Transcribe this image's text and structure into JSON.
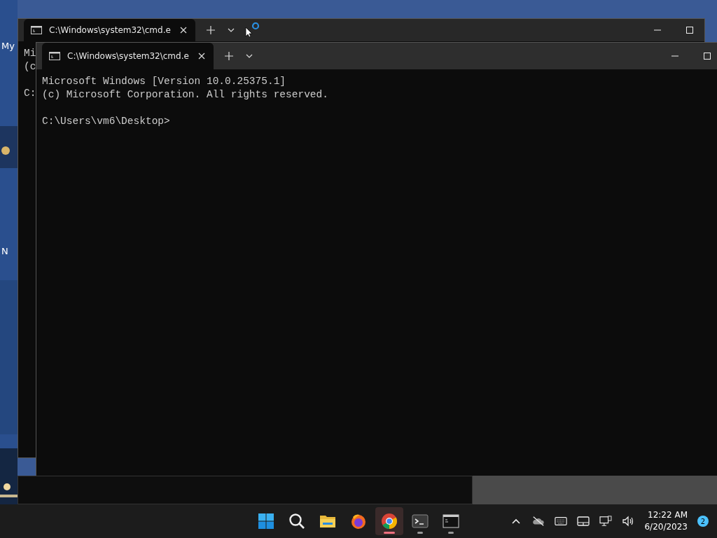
{
  "desktop": {
    "icon_labels": [
      "My",
      "N"
    ]
  },
  "windows": [
    {
      "tab": {
        "title": "C:\\Windows\\system32\\cmd.e",
        "selected": true
      },
      "blocks": [
        [
          "Mi",
          "(c"
        ],
        [
          "C:"
        ]
      ]
    },
    {
      "tab": {
        "title": "C:\\Windows\\system32\\cmd.e",
        "selected": true
      },
      "blocks": [
        [
          "Microsoft Windows [Version 10.0.25375.1]",
          "(c) Microsoft Corporation. All rights reserved."
        ],
        [
          "C:\\Users\\vm6\\Desktop>"
        ]
      ]
    }
  ],
  "taskbar": {
    "apps": [
      {
        "kind": "start",
        "selected": false,
        "running": false
      },
      {
        "kind": "search",
        "selected": false,
        "running": false
      },
      {
        "kind": "files",
        "selected": false,
        "running": false
      },
      {
        "kind": "firefox",
        "selected": false,
        "running": false
      },
      {
        "kind": "chrome",
        "selected": true,
        "running": true
      },
      {
        "kind": "terminal",
        "selected": false,
        "running": true
      },
      {
        "kind": "cmd",
        "selected": false,
        "running": true
      }
    ],
    "tray": [
      {
        "kind": "chevron"
      },
      {
        "kind": "cloud-off"
      },
      {
        "kind": "keyboard"
      },
      {
        "kind": "touchpad"
      },
      {
        "kind": "network"
      },
      {
        "kind": "volume"
      }
    ],
    "time": "12:22 AM",
    "date": "6/20/2023",
    "notifications": "2"
  }
}
